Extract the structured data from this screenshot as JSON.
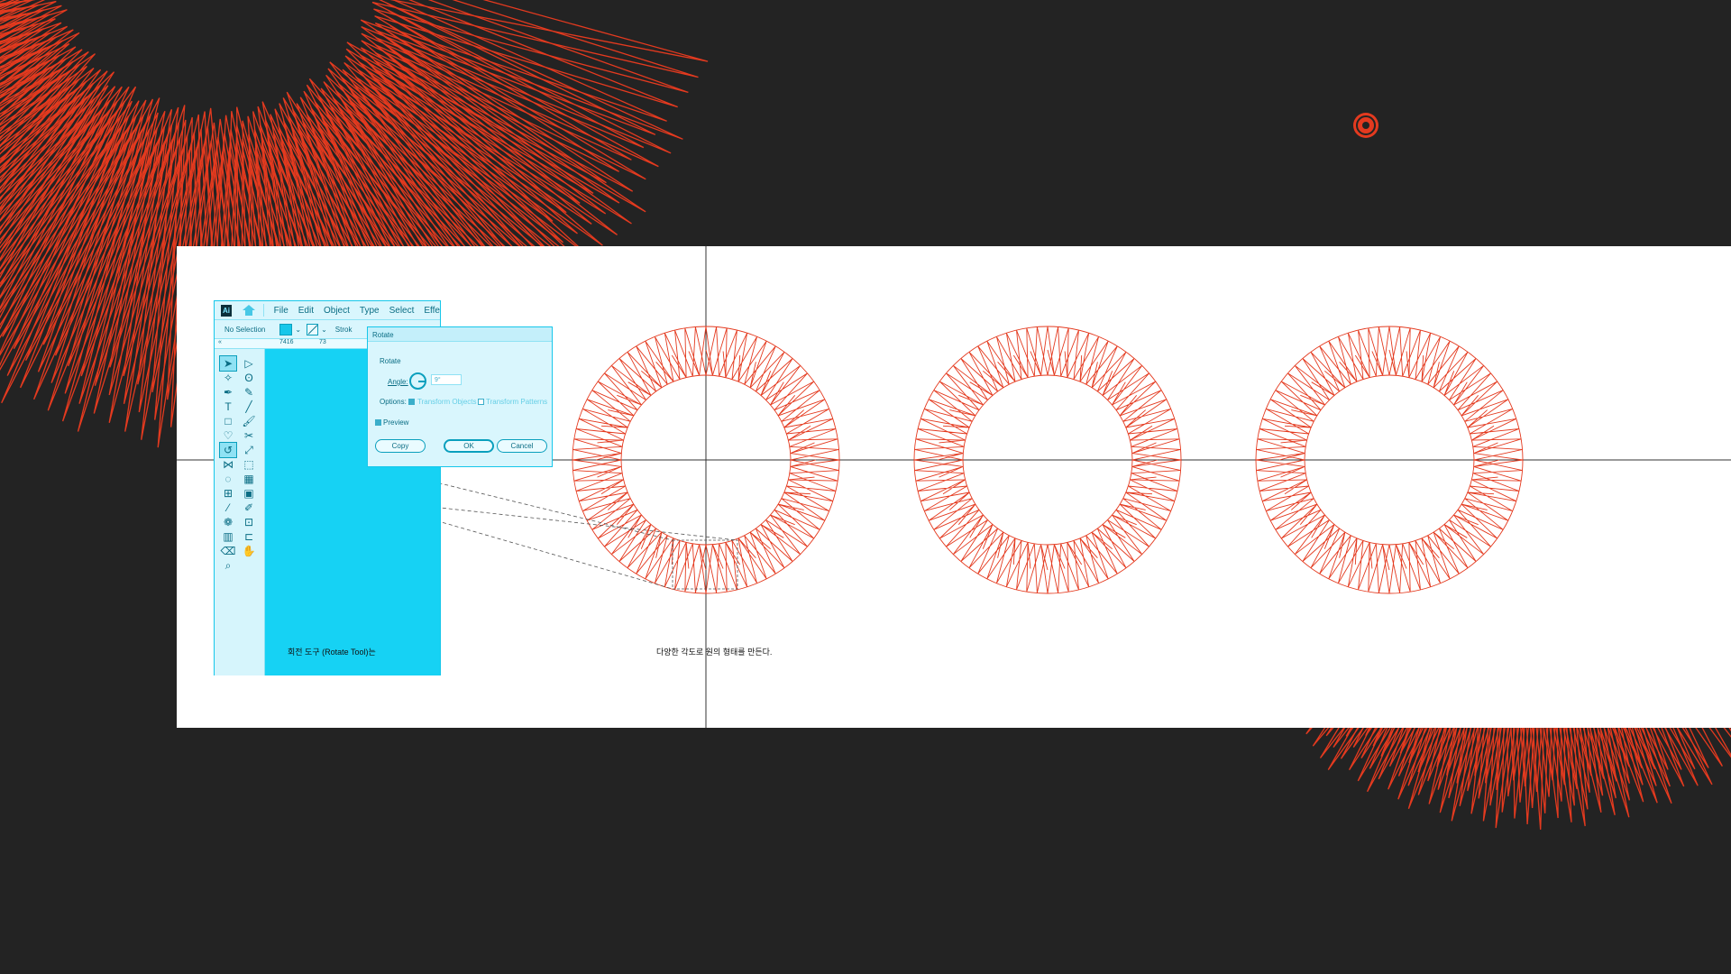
{
  "colors": {
    "background": "#232323",
    "accent_red": "#e43a1f",
    "ui_cyan": "#16d2f4",
    "panel": "#ffffff"
  },
  "illustrator": {
    "app_icon": "Ai",
    "menu": [
      "File",
      "Edit",
      "Object",
      "Type",
      "Select",
      "Effe"
    ],
    "control_bar": {
      "selection_label": "No Selection",
      "stroke_label": "Strok"
    },
    "ruler": [
      "7416",
      "73"
    ],
    "tools": [
      "selection-tool",
      "direct-selection-tool",
      "magic-wand-tool",
      "lasso-tool",
      "pen-tool",
      "curvature-tool",
      "type-tool",
      "line-tool",
      "rectangle-tool",
      "paintbrush-tool",
      "shaper-tool",
      "scissors-tool",
      "rotate-tool",
      "scale-tool",
      "width-tool",
      "free-transform-tool",
      "shape-builder-tool",
      "perspective-grid-tool",
      "mesh-tool",
      "gradient-tool",
      "eyedropper-tool",
      "blend-tool",
      "symbol-sprayer-tool",
      "artboard-tool",
      "graph-tool",
      "slice-tool",
      "eraser-tool",
      "hand-tool",
      "zoom-tool"
    ]
  },
  "rotate_dialog": {
    "title": "Rotate",
    "section": "Rotate",
    "angle_label": "Angle:",
    "angle_value": "9°",
    "options_label": "Options:",
    "option_transform_objects": "Transform Objects",
    "option_transform_patterns": "Transform Patterns",
    "preview_label": "Preview",
    "copy_button": "Copy",
    "ok_button": "OK",
    "cancel_button": "Cancel",
    "transform_objects_checked": true,
    "transform_patterns_checked": false,
    "preview_checked": true
  },
  "captions": {
    "left": "회전 도구 (Rotate Tool)는",
    "middle": "다양한 각도로 원의 형태를 만든다."
  },
  "artwork": {
    "ring_count": 3,
    "segments_per_ring": 40
  }
}
